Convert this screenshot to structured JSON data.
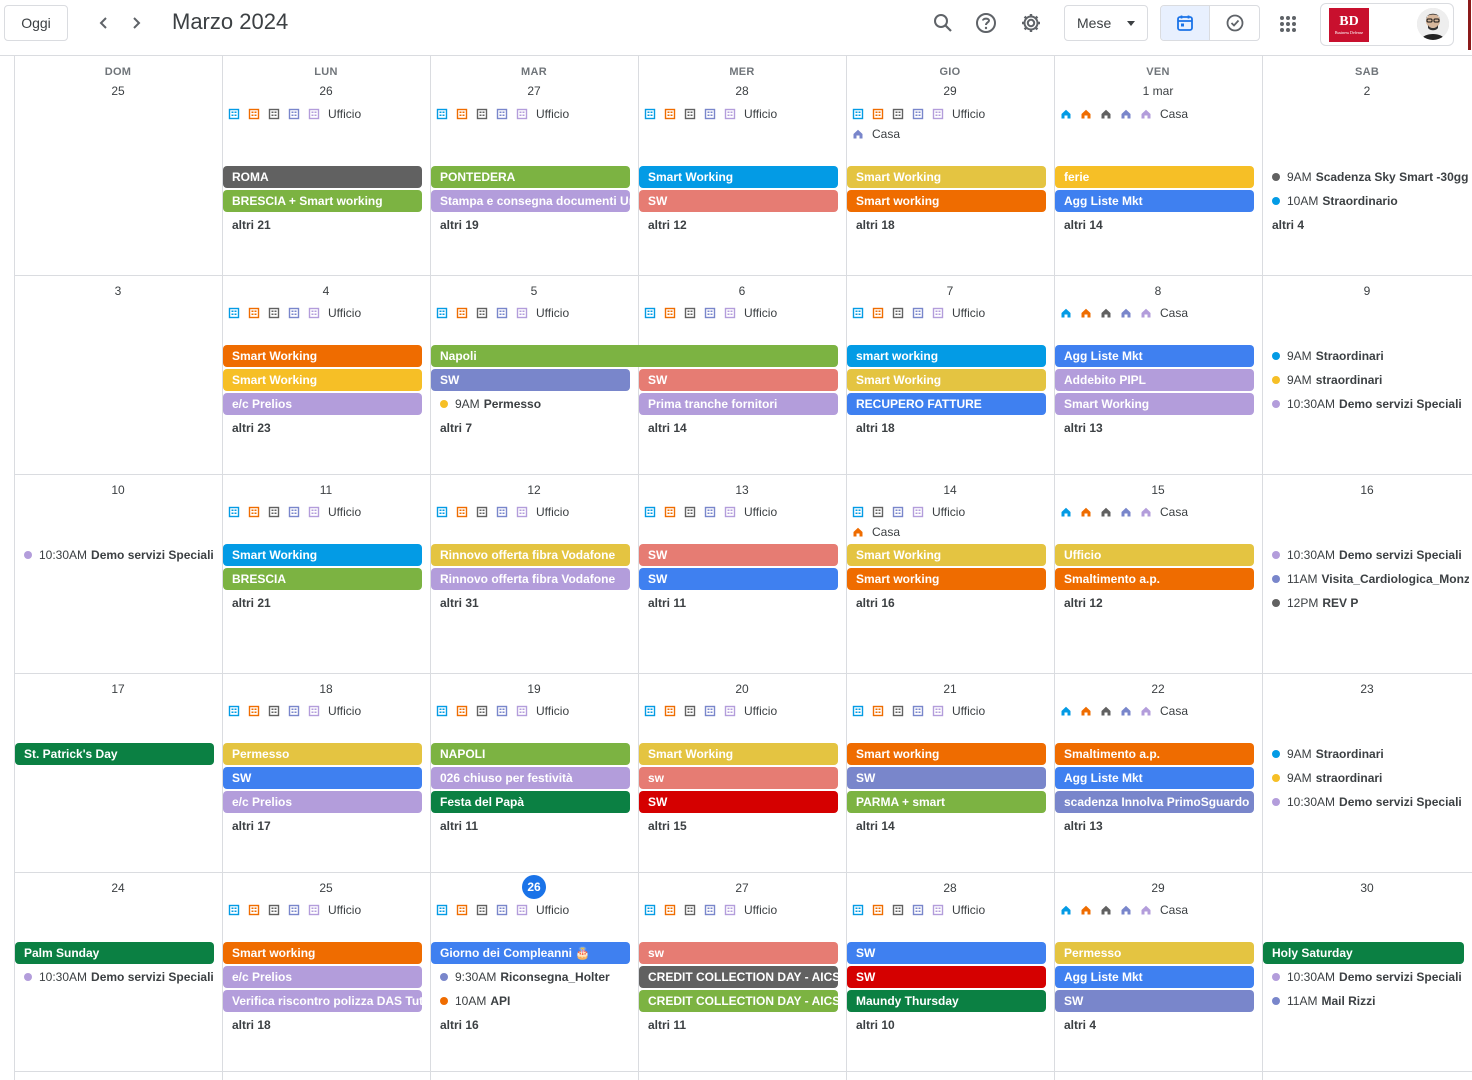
{
  "header": {
    "today_label": "Oggi",
    "title": "Marzo 2024",
    "view_label": "Mese",
    "brand_logo": "BD",
    "brand_logo_sub": "Business Defense"
  },
  "colors": {
    "accent": "#1a73e8",
    "grey": "#616161",
    "green": "#7cb342",
    "blue": "#039be5",
    "yellow": "#e4c441",
    "orange": "#ef6c00",
    "tomato_light": "#e67c73",
    "lavender": "#b39ddb",
    "blueberry": "#3f80f0",
    "sage": "#7986cb",
    "basil": "#0b8043",
    "banana": "#f6bf26",
    "red": "#d50000",
    "dark": "#616161"
  },
  "weekdays": [
    "DOM",
    "LUN",
    "MAR",
    "MER",
    "GIO",
    "VEN",
    "SAB"
  ],
  "weeks": [
    {
      "days": [
        "25",
        "26",
        "27",
        "28",
        "29",
        "1 mar",
        "2"
      ],
      "locations": [
        null,
        {
          "icons": "office",
          "label": "Ufficio"
        },
        {
          "icons": "office",
          "label": "Ufficio"
        },
        {
          "icons": "office",
          "label": "Ufficio"
        },
        {
          "icons": "office",
          "label": "Ufficio",
          "extra": "Casa"
        },
        {
          "icons": "home",
          "label": "Casa"
        },
        null
      ],
      "events": [
        [],
        [
          {
            "k": "chip",
            "c": "#616161",
            "t": "ROMA"
          },
          {
            "k": "chip",
            "c": "#7cb342",
            "t": "BRESCIA + Smart working"
          },
          {
            "k": "more",
            "t": "altri 21"
          }
        ],
        [
          {
            "k": "chip",
            "c": "#7cb342",
            "t": "PONTEDERA"
          },
          {
            "k": "chip",
            "c": "#b39ddb",
            "t": "Stampa e consegna documenti Ur"
          },
          {
            "k": "more",
            "t": "altri 19"
          }
        ],
        [
          {
            "k": "chip",
            "c": "#039be5",
            "t": "Smart Working"
          },
          {
            "k": "chip",
            "c": "#e67c73",
            "t": "SW"
          },
          {
            "k": "more",
            "t": "altri 12"
          }
        ],
        [
          {
            "k": "chip",
            "c": "#e4c441",
            "t": "Smart Working"
          },
          {
            "k": "chip",
            "c": "#ef6c00",
            "t": "Smart working"
          },
          {
            "k": "more",
            "t": "altri 18"
          }
        ],
        [
          {
            "k": "chip",
            "c": "#f6bf26",
            "t": "ferie"
          },
          {
            "k": "chip",
            "c": "#3f80f0",
            "t": "Agg Liste Mkt"
          },
          {
            "k": "more",
            "t": "altri 14"
          }
        ],
        [
          {
            "k": "dot",
            "c": "#616161",
            "time": "9AM",
            "t": "Scadenza Sky Smart -30gg"
          },
          {
            "k": "dot",
            "c": "#039be5",
            "time": "10AM",
            "t": "Straordinario"
          },
          {
            "k": "more",
            "t": "altri 4"
          }
        ]
      ]
    },
    {
      "days": [
        "3",
        "4",
        "5",
        "6",
        "7",
        "8",
        "9"
      ],
      "locations": [
        null,
        {
          "icons": "office",
          "label": "Ufficio"
        },
        {
          "icons": "office",
          "label": "Ufficio"
        },
        {
          "icons": "office",
          "label": "Ufficio"
        },
        {
          "icons": "office",
          "label": "Ufficio"
        },
        {
          "icons": "home",
          "label": "Casa"
        },
        null
      ],
      "events": [
        [],
        [
          {
            "k": "chip",
            "c": "#ef6c00",
            "t": "Smart Working"
          },
          {
            "k": "chip",
            "c": "#f6bf26",
            "t": "Smart Working"
          },
          {
            "k": "chip",
            "c": "#b39ddb",
            "t": "e/c Prelios"
          },
          {
            "k": "more",
            "t": "altri 23"
          }
        ],
        [
          {
            "k": "chip",
            "c": "#7cb342",
            "t": "Napoli",
            "span": 2
          },
          {
            "k": "chip",
            "c": "#7986cb",
            "t": "SW"
          },
          {
            "k": "dot",
            "c": "#f6bf26",
            "time": "9AM",
            "t": "Permesso"
          },
          {
            "k": "more",
            "t": "altri 7"
          }
        ],
        [
          {
            "k": "skip"
          },
          {
            "k": "chip",
            "c": "#e67c73",
            "t": "SW"
          },
          {
            "k": "chip",
            "c": "#b39ddb",
            "t": "Prima tranche fornitori"
          },
          {
            "k": "more",
            "t": "altri 14"
          }
        ],
        [
          {
            "k": "chip",
            "c": "#039be5",
            "t": "smart working"
          },
          {
            "k": "chip",
            "c": "#e4c441",
            "t": "Smart Working"
          },
          {
            "k": "chip",
            "c": "#3f80f0",
            "t": "RECUPERO FATTURE"
          },
          {
            "k": "more",
            "t": "altri 18"
          }
        ],
        [
          {
            "k": "chip",
            "c": "#3f80f0",
            "t": "Agg Liste Mkt"
          },
          {
            "k": "chip",
            "c": "#b39ddb",
            "t": "Addebito PIPL"
          },
          {
            "k": "chip",
            "c": "#b39ddb",
            "t": "Smart Working"
          },
          {
            "k": "more",
            "t": "altri 13"
          }
        ],
        [
          {
            "k": "dot",
            "c": "#039be5",
            "time": "9AM",
            "t": "Straordinari"
          },
          {
            "k": "dot",
            "c": "#f6bf26",
            "time": "9AM",
            "t": "straordinari"
          },
          {
            "k": "dot",
            "c": "#b39ddb",
            "time": "10:30AM",
            "t": "Demo servizi Speciali"
          }
        ]
      ]
    },
    {
      "days": [
        "10",
        "11",
        "12",
        "13",
        "14",
        "15",
        "16"
      ],
      "locations": [
        null,
        {
          "icons": "office",
          "label": "Ufficio"
        },
        {
          "icons": "office",
          "label": "Ufficio"
        },
        {
          "icons": "office",
          "label": "Ufficio"
        },
        {
          "icons": "office4",
          "label": "Ufficio",
          "extra": "Casa"
        },
        {
          "icons": "home",
          "label": "Casa"
        },
        null
      ],
      "events": [
        [
          {
            "k": "dot",
            "c": "#b39ddb",
            "time": "10:30AM",
            "t": "Demo servizi Speciali"
          }
        ],
        [
          {
            "k": "chip",
            "c": "#039be5",
            "t": "Smart Working"
          },
          {
            "k": "chip",
            "c": "#7cb342",
            "t": "BRESCIA"
          },
          {
            "k": "more",
            "t": "altri 21"
          }
        ],
        [
          {
            "k": "chip",
            "c": "#e4c441",
            "t": "Rinnovo offerta fibra Vodafone"
          },
          {
            "k": "chip",
            "c": "#b39ddb",
            "t": "Rinnovo offerta fibra Vodafone"
          },
          {
            "k": "more",
            "t": "altri 31"
          }
        ],
        [
          {
            "k": "chip",
            "c": "#e67c73",
            "t": "SW"
          },
          {
            "k": "chip",
            "c": "#3f80f0",
            "t": "SW"
          },
          {
            "k": "more",
            "t": "altri 11"
          }
        ],
        [
          {
            "k": "chip",
            "c": "#e4c441",
            "t": "Smart Working"
          },
          {
            "k": "chip",
            "c": "#ef6c00",
            "t": "Smart working"
          },
          {
            "k": "more",
            "t": "altri 16"
          }
        ],
        [
          {
            "k": "chip",
            "c": "#e4c441",
            "t": "Ufficio"
          },
          {
            "k": "chip",
            "c": "#ef6c00",
            "t": "Smaltimento a.p."
          },
          {
            "k": "more",
            "t": "altri 12"
          }
        ],
        [
          {
            "k": "dot",
            "c": "#b39ddb",
            "time": "10:30AM",
            "t": "Demo servizi Speciali"
          },
          {
            "k": "dot",
            "c": "#7986cb",
            "time": "11AM",
            "t": "Visita_Cardiologica_Monz"
          },
          {
            "k": "dot",
            "c": "#616161",
            "time": "12PM",
            "t": "REV P"
          }
        ]
      ]
    },
    {
      "days": [
        "17",
        "18",
        "19",
        "20",
        "21",
        "22",
        "23"
      ],
      "locations": [
        null,
        {
          "icons": "office",
          "label": "Ufficio"
        },
        {
          "icons": "office",
          "label": "Ufficio"
        },
        {
          "icons": "office",
          "label": "Ufficio"
        },
        {
          "icons": "office",
          "label": "Ufficio"
        },
        {
          "icons": "home",
          "label": "Casa"
        },
        null
      ],
      "events": [
        [
          {
            "k": "chip",
            "c": "#0b8043",
            "t": "St. Patrick's Day"
          }
        ],
        [
          {
            "k": "chip",
            "c": "#e4c441",
            "t": "Permesso"
          },
          {
            "k": "chip",
            "c": "#3f80f0",
            "t": "SW"
          },
          {
            "k": "chip",
            "c": "#b39ddb",
            "t": "e/c Prelios"
          },
          {
            "k": "more",
            "t": "altri 17"
          }
        ],
        [
          {
            "k": "chip",
            "c": "#7cb342",
            "t": "NAPOLI"
          },
          {
            "k": "chip",
            "c": "#b39ddb",
            "t": "026 chiuso per festività"
          },
          {
            "k": "chip",
            "c": "#0b8043",
            "t": "Festa del Papà"
          },
          {
            "k": "more",
            "t": "altri 11"
          }
        ],
        [
          {
            "k": "chip",
            "c": "#e4c441",
            "t": "Smart Working"
          },
          {
            "k": "chip",
            "c": "#e67c73",
            "t": "sw"
          },
          {
            "k": "chip",
            "c": "#d50000",
            "t": "SW"
          },
          {
            "k": "more",
            "t": "altri 15"
          }
        ],
        [
          {
            "k": "chip",
            "c": "#ef6c00",
            "t": "Smart working"
          },
          {
            "k": "chip",
            "c": "#7986cb",
            "t": "SW"
          },
          {
            "k": "chip",
            "c": "#7cb342",
            "t": "PARMA + smart"
          },
          {
            "k": "more",
            "t": "altri 14"
          }
        ],
        [
          {
            "k": "chip",
            "c": "#ef6c00",
            "t": "Smaltimento a.p."
          },
          {
            "k": "chip",
            "c": "#3f80f0",
            "t": "Agg Liste Mkt"
          },
          {
            "k": "chip",
            "c": "#7986cb",
            "t": "scadenza Innolva PrimoSguardo"
          },
          {
            "k": "more",
            "t": "altri 13"
          }
        ],
        [
          {
            "k": "dot",
            "c": "#039be5",
            "time": "9AM",
            "t": "Straordinari"
          },
          {
            "k": "dot",
            "c": "#f6bf26",
            "time": "9AM",
            "t": "straordinari"
          },
          {
            "k": "dot",
            "c": "#b39ddb",
            "time": "10:30AM",
            "t": "Demo servizi Speciali"
          }
        ]
      ]
    },
    {
      "days": [
        "24",
        "25",
        "26",
        "27",
        "28",
        "29",
        "30"
      ],
      "today_index": 2,
      "locations": [
        null,
        {
          "icons": "office",
          "label": "Ufficio"
        },
        {
          "icons": "office",
          "label": "Ufficio"
        },
        {
          "icons": "office",
          "label": "Ufficio"
        },
        {
          "icons": "office",
          "label": "Ufficio"
        },
        {
          "icons": "home",
          "label": "Casa"
        },
        null
      ],
      "events": [
        [
          {
            "k": "chip",
            "c": "#0b8043",
            "t": "Palm Sunday"
          },
          {
            "k": "dot",
            "c": "#b39ddb",
            "time": "10:30AM",
            "t": "Demo servizi Speciali"
          }
        ],
        [
          {
            "k": "chip",
            "c": "#ef6c00",
            "t": "Smart working"
          },
          {
            "k": "chip",
            "c": "#b39ddb",
            "t": "e/c Prelios"
          },
          {
            "k": "chip",
            "c": "#b39ddb",
            "t": "Verifica riscontro polizza DAS Tut"
          },
          {
            "k": "more",
            "t": "altri 18"
          }
        ],
        [
          {
            "k": "chip",
            "c": "#3f80f0",
            "t": "Giorno dei Compleanni 🎂"
          },
          {
            "k": "dot",
            "c": "#7986cb",
            "time": "9:30AM",
            "t": "Riconsegna_Holter"
          },
          {
            "k": "dot",
            "c": "#ef6c00",
            "time": "10AM",
            "t": "API"
          },
          {
            "k": "more",
            "t": "altri 16"
          }
        ],
        [
          {
            "k": "chip",
            "c": "#e67c73",
            "t": "sw"
          },
          {
            "k": "chip",
            "c": "#616161",
            "t": "CREDIT COLLECTION DAY - AICS I"
          },
          {
            "k": "chip",
            "c": "#7cb342",
            "t": "CREDIT COLLECTION DAY - AICS I"
          },
          {
            "k": "more",
            "t": "altri 11"
          }
        ],
        [
          {
            "k": "chip",
            "c": "#3f80f0",
            "t": "SW"
          },
          {
            "k": "chip",
            "c": "#d50000",
            "t": "SW"
          },
          {
            "k": "chip",
            "c": "#0b8043",
            "t": "Maundy Thursday"
          },
          {
            "k": "more",
            "t": "altri 10"
          }
        ],
        [
          {
            "k": "chip",
            "c": "#e4c441",
            "t": "Permesso"
          },
          {
            "k": "chip",
            "c": "#3f80f0",
            "t": "Agg Liste Mkt"
          },
          {
            "k": "chip",
            "c": "#7986cb",
            "t": "SW"
          },
          {
            "k": "more",
            "t": "altri 4"
          }
        ],
        [
          {
            "k": "chip",
            "c": "#0b8043",
            "t": "Holy Saturday"
          },
          {
            "k": "dot",
            "c": "#b39ddb",
            "time": "10:30AM",
            "t": "Demo servizi Speciali"
          },
          {
            "k": "dot",
            "c": "#7986cb",
            "time": "11AM",
            "t": "Mail Rizzi"
          }
        ]
      ]
    }
  ]
}
